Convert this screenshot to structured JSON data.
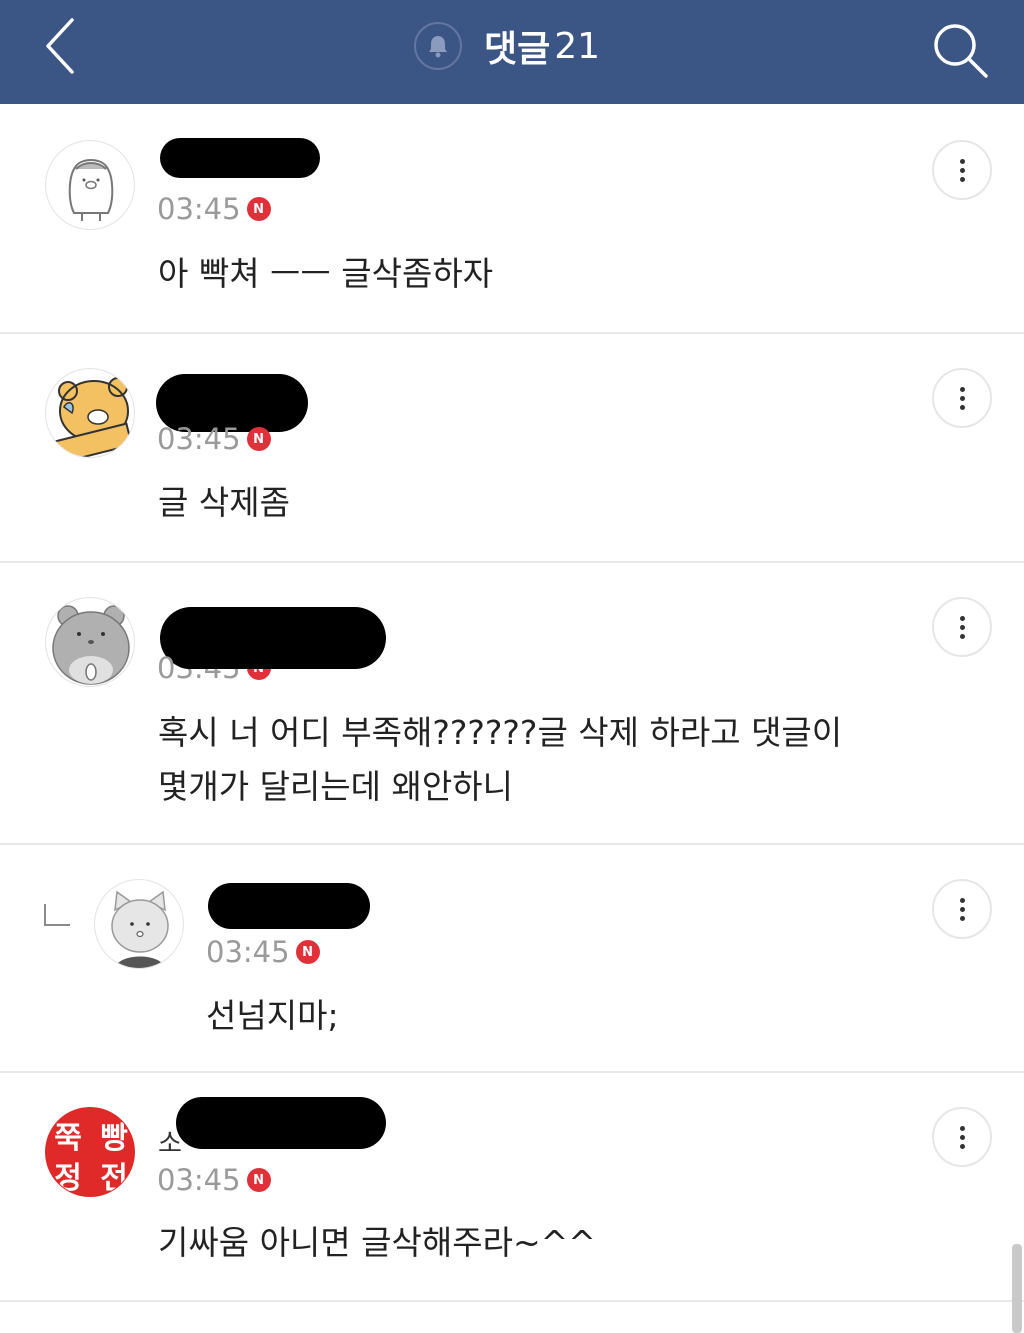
{
  "header": {
    "title": "댓글",
    "count": "21",
    "back_icon": "chevron-left-icon",
    "bell_icon": "bell-icon",
    "search_icon": "search-icon",
    "background_color": "#3b5585"
  },
  "comments": [
    {
      "nickname_partial": "",
      "time": "03:45",
      "new_badge": "N",
      "text": "아 빡쳐 ㅡㅡ 글삭좀하자",
      "avatar": "penguin-avatar"
    },
    {
      "nickname_partial": "",
      "time": "03:45",
      "new_badge": "N",
      "text": "글 삭제좀",
      "avatar": "lion-avatar"
    },
    {
      "nickname_partial": "",
      "time": "03:45",
      "new_badge": "N",
      "text": "혹시 너 어디 부족해??????글 삭제 하라고 댓글이\n몇개가 달리는데 왜안하니",
      "avatar": "hamster-avatar"
    },
    {
      "nickname_partial": "",
      "time": "03:45",
      "new_badge": "N",
      "text": "선넘지마;",
      "avatar": "cat-avatar",
      "is_reply": true
    },
    {
      "nickname_partial": "소",
      "time": "03:45",
      "new_badge": "N",
      "text": "기싸움 아니면 글삭해주라~^^",
      "avatar": "text-avatar",
      "avatar_text": [
        "쭉",
        "빵",
        "정",
        "전"
      ]
    }
  ],
  "colors": {
    "badge_red": "#e0303a",
    "time_gray": "#9a9a9a"
  }
}
